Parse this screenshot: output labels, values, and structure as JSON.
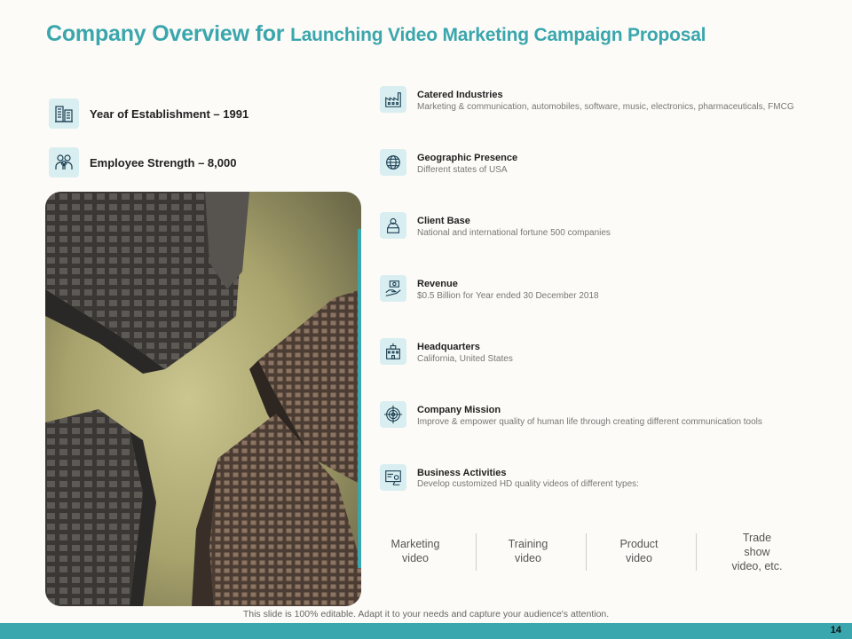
{
  "title": {
    "part1": "Company Overview for ",
    "part2": "Launching Video Marketing Campaign Proposal"
  },
  "left_facts": [
    {
      "label": "Year of Establishment – 1991",
      "icon": "building-icon"
    },
    {
      "label": "Employee Strength – 8,000",
      "icon": "employees-icon"
    }
  ],
  "items": [
    {
      "title": "Catered Industries",
      "desc": "Marketing & communication, automobiles, software, music, electronics, pharmaceuticals, FMCG",
      "icon": "factory-icon"
    },
    {
      "title": "Geographic Presence",
      "desc": "Different states of USA",
      "icon": "globe-icon"
    },
    {
      "title": "Client Base",
      "desc": "National and international fortune 500 companies",
      "icon": "client-icon"
    },
    {
      "title": "Revenue",
      "desc": "$0.5 Billion for Year ended 30 December 2018",
      "icon": "money-hand-icon"
    },
    {
      "title": "Headquarters",
      "desc": "California, United States",
      "icon": "headquarters-icon"
    },
    {
      "title": "Company Mission",
      "desc": "Improve & empower quality of human life through creating different communication tools",
      "icon": "target-icon"
    },
    {
      "title": "Business Activities",
      "desc": "Develop customized HD quality videos of different types:",
      "icon": "presentation-icon"
    }
  ],
  "video_types": [
    "Marketing\nvideo",
    "Training\nvideo",
    "Product\nvideo",
    "Trade\nshow\nvideo, etc."
  ],
  "footer_note": "This slide is 100% editable. Adapt it to your needs and capture your audience's attention.",
  "page_number": "14",
  "colors": {
    "accent": "#3aa6ad",
    "icon_bg": "#d9eef0",
    "background": "#fcfbf7"
  }
}
